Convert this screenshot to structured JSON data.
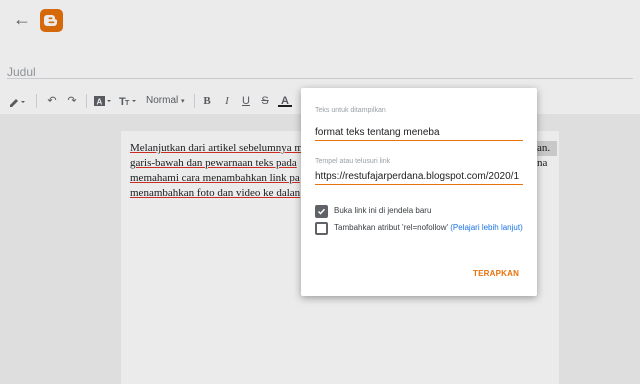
{
  "header": {
    "back_icon": "arrow-back-icon",
    "logo_icon": "blogger-logo-icon",
    "brand_color": "#e8710a"
  },
  "title": {
    "placeholder": "Judul",
    "value": ""
  },
  "toolbar": {
    "items": [
      "pen-icon",
      "undo-icon",
      "redo-icon",
      "text-color-icon",
      "font-size-icon"
    ],
    "format_label": "Normal",
    "bold": "B",
    "italic": "I",
    "underline": "U",
    "strikethrough": "S",
    "text_color": "A"
  },
  "editor": {
    "lines": [
      "Melanjutkan dari artikel sebelumnya m",
      "garis-bawah dan pewarnaan teks pada",
      "memahami cara menambahkan link pa",
      "menambahkan foto dan video ke dalan"
    ],
    "highlight_right": [
      "an.",
      "na"
    ]
  },
  "dialog": {
    "display_text_label": "Teks untuk ditampilkan",
    "display_text_value": "format teks tentang meneba",
    "url_label": "Tempel atau telusuri link",
    "url_value": "https://restufajarperdana.blogspot.com/2020/1",
    "open_new_window_label": "Buka link ini di jendela baru",
    "open_new_window_checked": true,
    "nofollow_label": "Tambahkan atribut 'rel=nofollow'",
    "nofollow_link": "(Pelajari lebih lanjut)",
    "nofollow_checked": false,
    "apply_label": "TERAPKAN"
  }
}
